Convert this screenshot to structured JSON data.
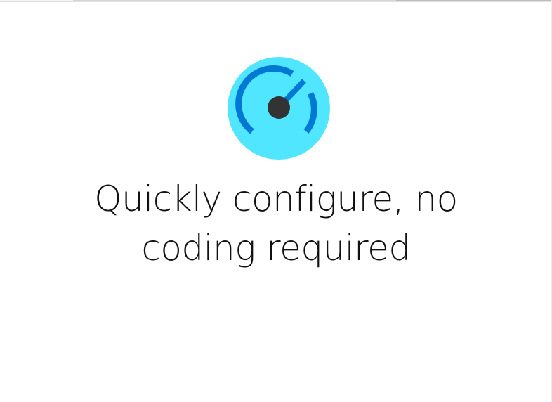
{
  "hero": {
    "icon": "speedometer-icon",
    "headline": "Quickly configure, no coding required"
  },
  "colors": {
    "icon_background": "#50E6FF",
    "icon_arc": "#0078D4",
    "icon_needle": "#333333"
  }
}
